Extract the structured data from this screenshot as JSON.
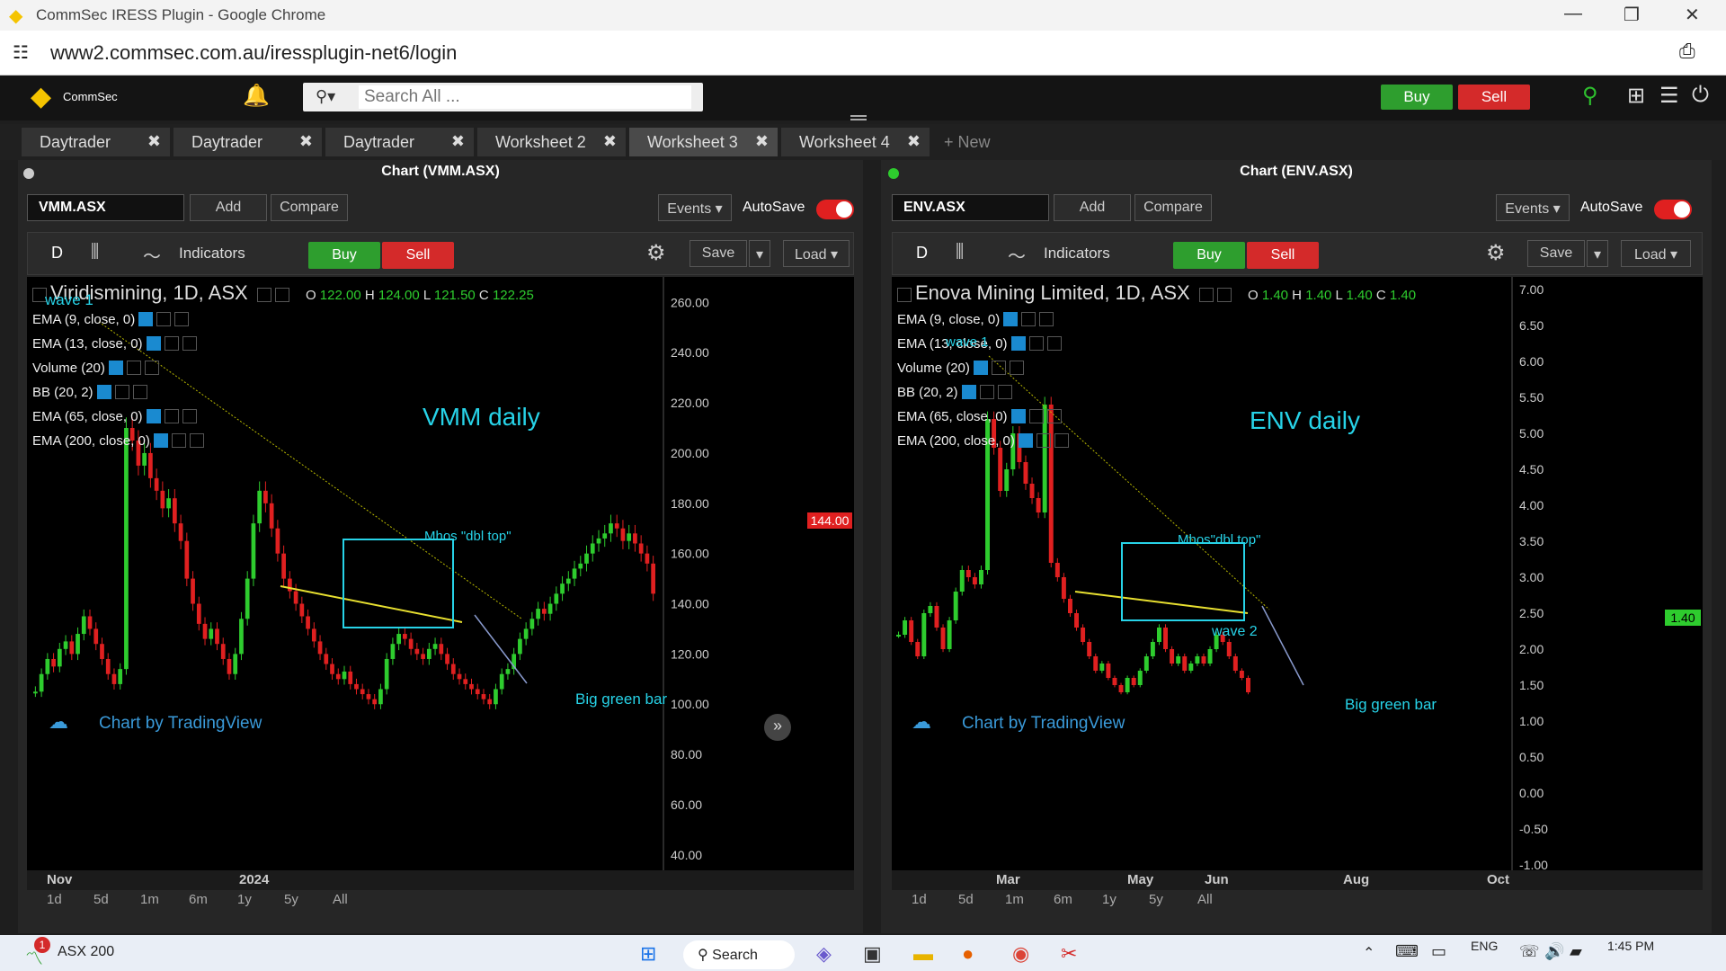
{
  "window": {
    "title": "CommSec IRESS Plugin - Google Chrome"
  },
  "browser": {
    "url": "www2.commsec.com.au/iressplugin-net6/login"
  },
  "header": {
    "brand": "CommSec",
    "search_placeholder": "Search All ...",
    "buy": "Buy",
    "sell": "Sell"
  },
  "tabs": [
    {
      "label": "Daytrader"
    },
    {
      "label": "Daytrader"
    },
    {
      "label": "Daytrader"
    },
    {
      "label": "Worksheet 2"
    },
    {
      "label": "Worksheet 3"
    },
    {
      "label": "Worksheet 4"
    }
  ],
  "new_tab": "+ New",
  "left": {
    "panel_title": "Chart (VMM.ASX)",
    "symbol": "VMM.ASX",
    "add": "Add",
    "compare": "Compare",
    "events": "Events",
    "autosave": "AutoSave",
    "interval": "D",
    "indicators": "Indicators",
    "buy": "Buy",
    "sell": "Sell",
    "save": "Save",
    "load": "Load",
    "instrument": "Viridismining, 1D, ASX",
    "ohlc": {
      "o": "122.00",
      "h": "124.00",
      "l": "121.50",
      "c": "122.25"
    },
    "legend": [
      "EMA (9, close, 0)",
      "EMA (13, close, 0)",
      "Volume (20)",
      "BB (20, 2)",
      "EMA (65, close, 0)",
      "EMA (200, close, 0)"
    ],
    "annotation_title": "VMM daily",
    "annotation_box": "Mhos \"dbl top\"",
    "annotation_bar": "Big green bar",
    "annotation_wave": "wave 1",
    "tradingview": "Chart by TradingView",
    "price_tag": "144.00",
    "x_labels": [
      "Nov",
      "2024"
    ],
    "ranges": [
      "1d",
      "5d",
      "1m",
      "6m",
      "1y",
      "5y",
      "All"
    ]
  },
  "right": {
    "panel_title": "Chart (ENV.ASX)",
    "symbol": "ENV.ASX",
    "add": "Add",
    "compare": "Compare",
    "events": "Events",
    "autosave": "AutoSave",
    "interval": "D",
    "indicators": "Indicators",
    "buy": "Buy",
    "sell": "Sell",
    "save": "Save",
    "load": "Load",
    "instrument": "Enova Mining Limited, 1D, ASX",
    "ohlc": {
      "o": "1.40",
      "h": "1.40",
      "l": "1.40",
      "c": "1.40"
    },
    "legend": [
      "EMA (9, close, 0)",
      "EMA (13, close, 0)",
      "Volume (20)",
      "BB (20, 2)",
      "EMA (65, close, 0)",
      "EMA (200, close, 0)"
    ],
    "annotation_title": "ENV daily",
    "annotation_box": "Mhos\"dbl top\"",
    "annotation_bar": "Big green bar",
    "annotation_wave1": "wave 1",
    "annotation_wave2": "wave 2",
    "tradingview": "Chart by TradingView",
    "price_tag": "1.40",
    "x_labels": [
      "Mar",
      "May",
      "Jun",
      "Aug",
      "Oct"
    ],
    "ranges": [
      "1d",
      "5d",
      "1m",
      "6m",
      "1y",
      "5y",
      "All"
    ]
  },
  "taskbar": {
    "ticker": "ASX 200",
    "badge": "1",
    "search": "Search",
    "lang": "ENG",
    "time": "1:45 PM"
  },
  "chart_data": [
    {
      "type": "candlestick",
      "title": "Viridismining, 1D, ASX",
      "yticks": [
        40,
        60,
        80,
        100,
        120,
        140,
        160,
        180,
        200,
        220,
        240,
        260
      ],
      "ylim": [
        36,
        268
      ],
      "xlabels": [
        "Nov",
        "2024"
      ],
      "series_close": [
        105,
        112,
        118,
        115,
        122,
        125,
        120,
        128,
        135,
        130,
        124,
        118,
        112,
        108,
        114,
        210,
        205,
        195,
        200,
        190,
        185,
        178,
        182,
        172,
        165,
        150,
        140,
        132,
        126,
        130,
        124,
        118,
        112,
        120,
        134,
        150,
        172,
        185,
        180,
        170,
        160,
        150,
        145,
        140,
        135,
        130,
        125,
        120,
        116,
        112,
        110,
        113,
        108,
        106,
        104,
        102,
        100,
        106,
        118,
        124,
        128,
        126,
        122,
        120,
        118,
        122,
        124,
        120,
        116,
        112,
        110,
        108,
        106,
        104,
        102,
        100,
        106,
        112,
        114,
        120,
        126,
        130,
        134,
        138,
        136,
        140,
        144,
        148,
        150,
        154,
        156,
        160,
        164,
        166,
        168,
        172,
        170,
        165,
        168,
        164,
        160,
        156,
        144
      ]
    },
    {
      "type": "candlestick",
      "title": "Enova Mining Limited, 1D, ASX",
      "yticks": [
        -1.0,
        -0.5,
        0.0,
        0.5,
        1.0,
        1.5,
        2.0,
        2.5,
        3.0,
        3.5,
        4.0,
        4.5,
        5.0,
        5.5,
        6.0,
        6.5,
        7.0
      ],
      "ylim": [
        -1.0,
        7.1
      ],
      "xlabels": [
        "Mar",
        "May",
        "Jun",
        "Aug",
        "Oct"
      ],
      "series_close": [
        2.2,
        2.4,
        2.1,
        1.9,
        2.5,
        2.6,
        2.3,
        2.0,
        2.4,
        2.8,
        3.1,
        3.0,
        2.9,
        3.1,
        5.2,
        4.8,
        4.2,
        4.5,
        5.0,
        4.6,
        4.3,
        4.1,
        3.9,
        5.4,
        3.2,
        3.0,
        2.7,
        2.5,
        2.3,
        2.1,
        1.9,
        1.7,
        1.8,
        1.6,
        1.5,
        1.4,
        1.6,
        1.5,
        1.7,
        1.9,
        2.1,
        2.3,
        2.0,
        1.8,
        1.9,
        1.7,
        1.8,
        1.9,
        1.8,
        2.0,
        2.2,
        2.1,
        1.9,
        1.7,
        1.6,
        1.4
      ]
    }
  ]
}
